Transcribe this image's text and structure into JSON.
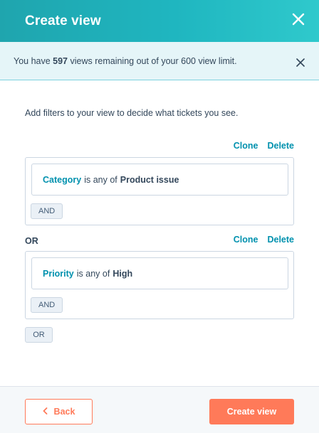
{
  "header": {
    "title": "Create view"
  },
  "notice": {
    "prefix": "You have ",
    "count": "597",
    "suffix": " views remaining out of your 600 view limit."
  },
  "intro": "Add filters to your view to decide what tickets you see.",
  "groups": [
    {
      "clone_label": "Clone",
      "delete_label": "Delete",
      "condition": {
        "property": "Category",
        "operator": "is any of",
        "value": "Product issue"
      },
      "and_label": "AND"
    },
    {
      "or_label": "OR",
      "clone_label": "Clone",
      "delete_label": "Delete",
      "condition": {
        "property": "Priority",
        "operator": "is any of",
        "value": "High"
      },
      "and_label": "AND"
    }
  ],
  "add_or_label": "OR",
  "footer": {
    "back_label": "Back",
    "create_label": "Create view"
  },
  "colors": {
    "accent": "#1fb6c0",
    "link": "#0091ae",
    "primary_button": "#ff7a59"
  },
  "icons": {
    "close": "close-icon",
    "back": "chevron-left-icon"
  }
}
